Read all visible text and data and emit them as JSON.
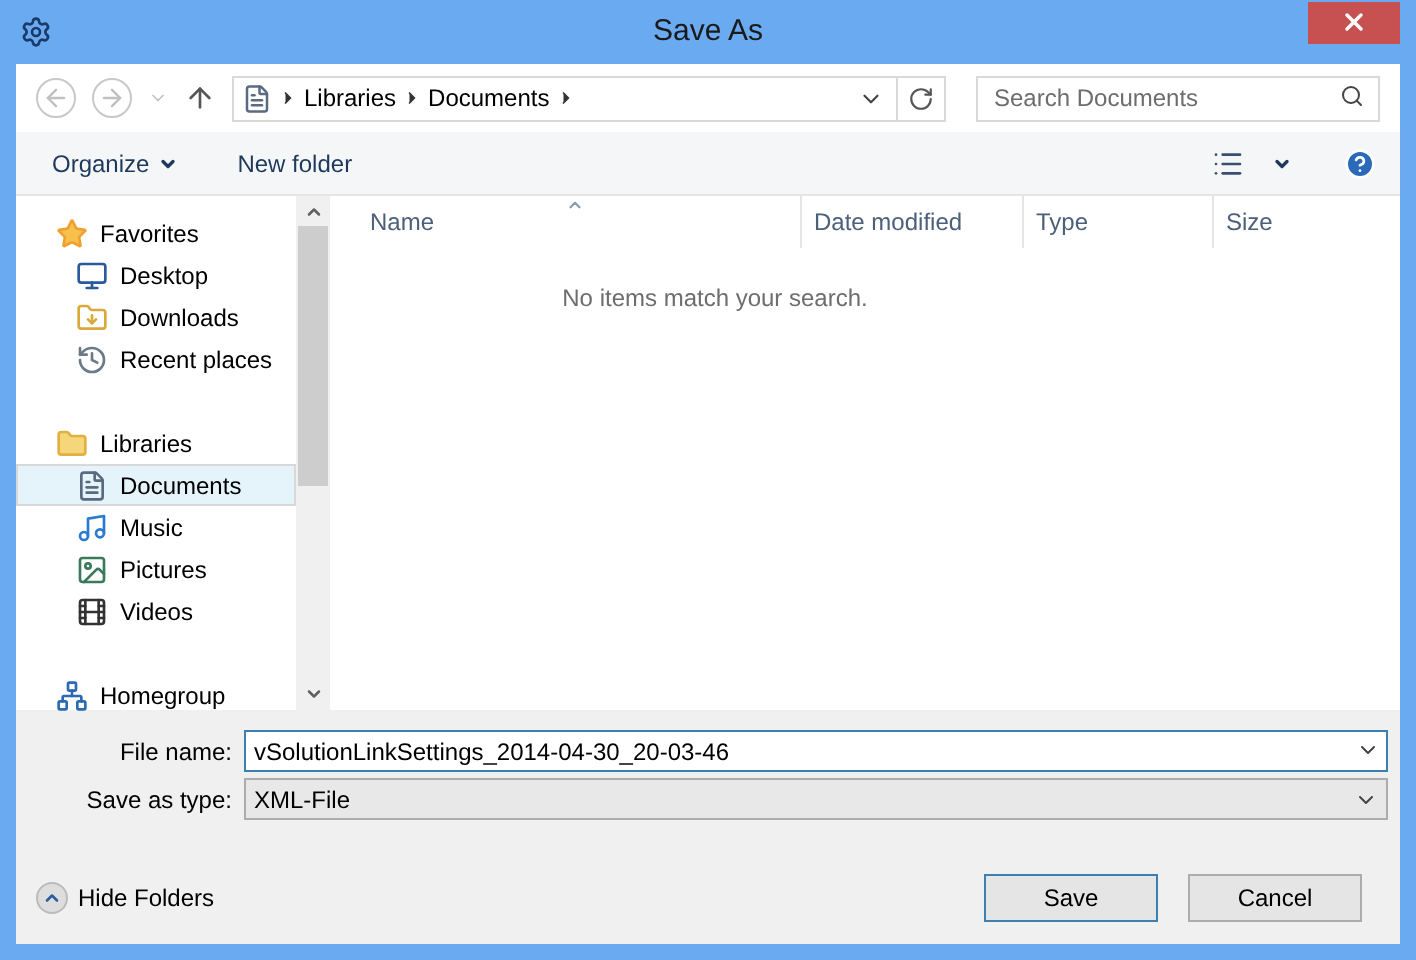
{
  "window": {
    "title": "Save As"
  },
  "address": {
    "segments": [
      "Libraries",
      "Documents"
    ]
  },
  "search": {
    "placeholder": "Search Documents"
  },
  "toolbar": {
    "organize": "Organize",
    "new_folder": "New folder"
  },
  "sidebar": {
    "groups": [
      {
        "label": "Favorites",
        "selected": false,
        "children": [
          {
            "label": "Desktop",
            "selected": false
          },
          {
            "label": "Downloads",
            "selected": false
          },
          {
            "label": "Recent places",
            "selected": false
          }
        ]
      },
      {
        "label": "Libraries",
        "selected": false,
        "children": [
          {
            "label": "Documents",
            "selected": true
          },
          {
            "label": "Music",
            "selected": false
          },
          {
            "label": "Pictures",
            "selected": false
          },
          {
            "label": "Videos",
            "selected": false
          }
        ]
      },
      {
        "label": "Homegroup",
        "selected": false
      }
    ]
  },
  "table": {
    "columns": [
      {
        "label": "Name",
        "sorted": true
      },
      {
        "label": "Date modified",
        "sorted": false
      },
      {
        "label": "Type",
        "sorted": false
      },
      {
        "label": "Size",
        "sorted": false
      }
    ],
    "empty_message": "No items match your search."
  },
  "form": {
    "file_name_label": "File name:",
    "file_name": "vSolutionLinkSettings_2014-04-30_20-03-46",
    "type_label": "Save as type:",
    "type": "XML-File"
  },
  "footer": {
    "hide_folders": "Hide Folders",
    "buttons": [
      {
        "label": "Save",
        "default": true
      },
      {
        "label": "Cancel",
        "default": false
      }
    ]
  }
}
